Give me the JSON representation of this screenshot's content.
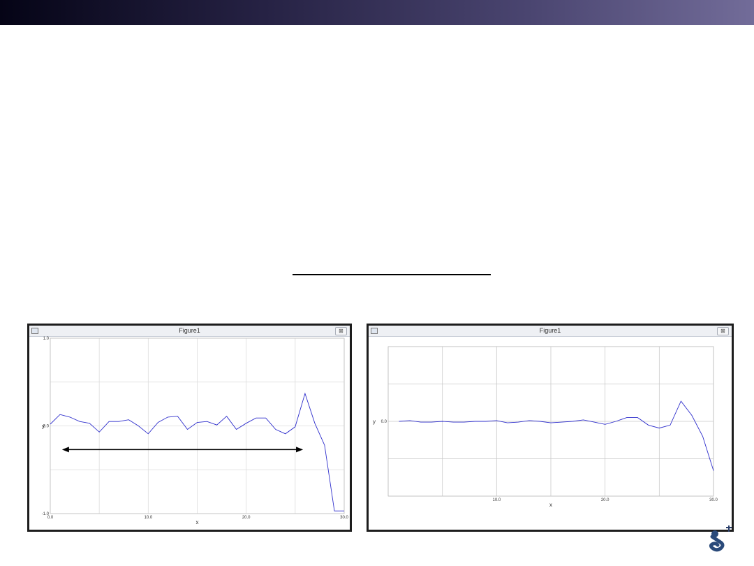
{
  "slide": {
    "header_color_start": "#050416",
    "header_color_end": "#726c99"
  },
  "figures": [
    {
      "window_title": "Figure1",
      "close_symbol": "⊠"
    },
    {
      "window_title": "Figure1",
      "close_symbol": "⊠"
    }
  ],
  "chart_data": [
    {
      "type": "line",
      "xlabel": "x",
      "ylabel": "y",
      "xlim": [
        0,
        30
      ],
      "ylim": [
        -1.0,
        1.0
      ],
      "xticks": [
        0,
        10,
        20,
        30
      ],
      "xtick_labels": [
        "0.0",
        "10.0",
        "20.0",
        "30.0"
      ],
      "yticks": [
        -1.0,
        0.0,
        1.0
      ],
      "ytick_labels": [
        "-1.0",
        "0.0",
        "1.0"
      ],
      "grid": true,
      "line_color": "#2e2ecc",
      "annotation": "double-headed arrow",
      "series": [
        {
          "x": [
            0.0,
            1.0,
            2.0,
            3.0,
            4.0,
            5.0,
            6.0,
            7.0,
            8.0,
            9.0,
            10.0,
            11.0,
            12.0,
            13.0,
            14.0,
            15.0,
            16.0,
            17.0,
            18.0,
            19.0,
            20.0,
            21.0,
            22.0,
            23.0,
            24.0,
            25.0,
            26.0,
            27.0,
            28.0,
            29.0,
            30.0
          ],
          "y": [
            0.02,
            0.13,
            0.1,
            0.05,
            0.03,
            -0.07,
            0.05,
            0.05,
            0.07,
            0.0,
            -0.09,
            0.04,
            0.1,
            0.11,
            -0.04,
            0.04,
            0.05,
            0.01,
            0.11,
            -0.04,
            0.03,
            0.09,
            0.09,
            -0.04,
            -0.09,
            -0.01,
            0.37,
            0.03,
            -0.22,
            -0.97,
            -0.97
          ]
        }
      ],
      "arrow": {
        "x_start": 1.2,
        "x_end": 25.8,
        "y": -0.27
      }
    },
    {
      "type": "line",
      "xlabel": "x",
      "ylabel": "y",
      "xlim": [
        0,
        30
      ],
      "ylim": [
        -1.0,
        1.0
      ],
      "xticks": [
        10,
        20,
        30
      ],
      "xtick_labels": [
        "10.0",
        "20.0",
        "30.0"
      ],
      "yticks": [
        0.0
      ],
      "ytick_labels": [
        "0.0"
      ],
      "grid": true,
      "line_color": "#2e2ecc",
      "series": [
        {
          "x": [
            1.0,
            2.0,
            3.0,
            4.0,
            5.0,
            6.0,
            7.0,
            8.0,
            9.0,
            10.0,
            11.0,
            12.0,
            13.0,
            14.0,
            15.0,
            16.0,
            17.0,
            18.0,
            19.0,
            20.0,
            21.0,
            22.0,
            23.0,
            24.0,
            25.0,
            26.0,
            27.0,
            28.0,
            29.0,
            30.0
          ],
          "y": [
            0.0,
            0.01,
            -0.01,
            -0.01,
            0.0,
            -0.01,
            -0.01,
            0.0,
            0.0,
            0.01,
            -0.02,
            -0.01,
            0.01,
            0.0,
            -0.02,
            -0.01,
            0.0,
            0.02,
            -0.01,
            -0.04,
            0.0,
            0.05,
            0.05,
            -0.05,
            -0.09,
            -0.05,
            0.27,
            0.08,
            -0.2,
            -0.66
          ]
        }
      ]
    }
  ]
}
